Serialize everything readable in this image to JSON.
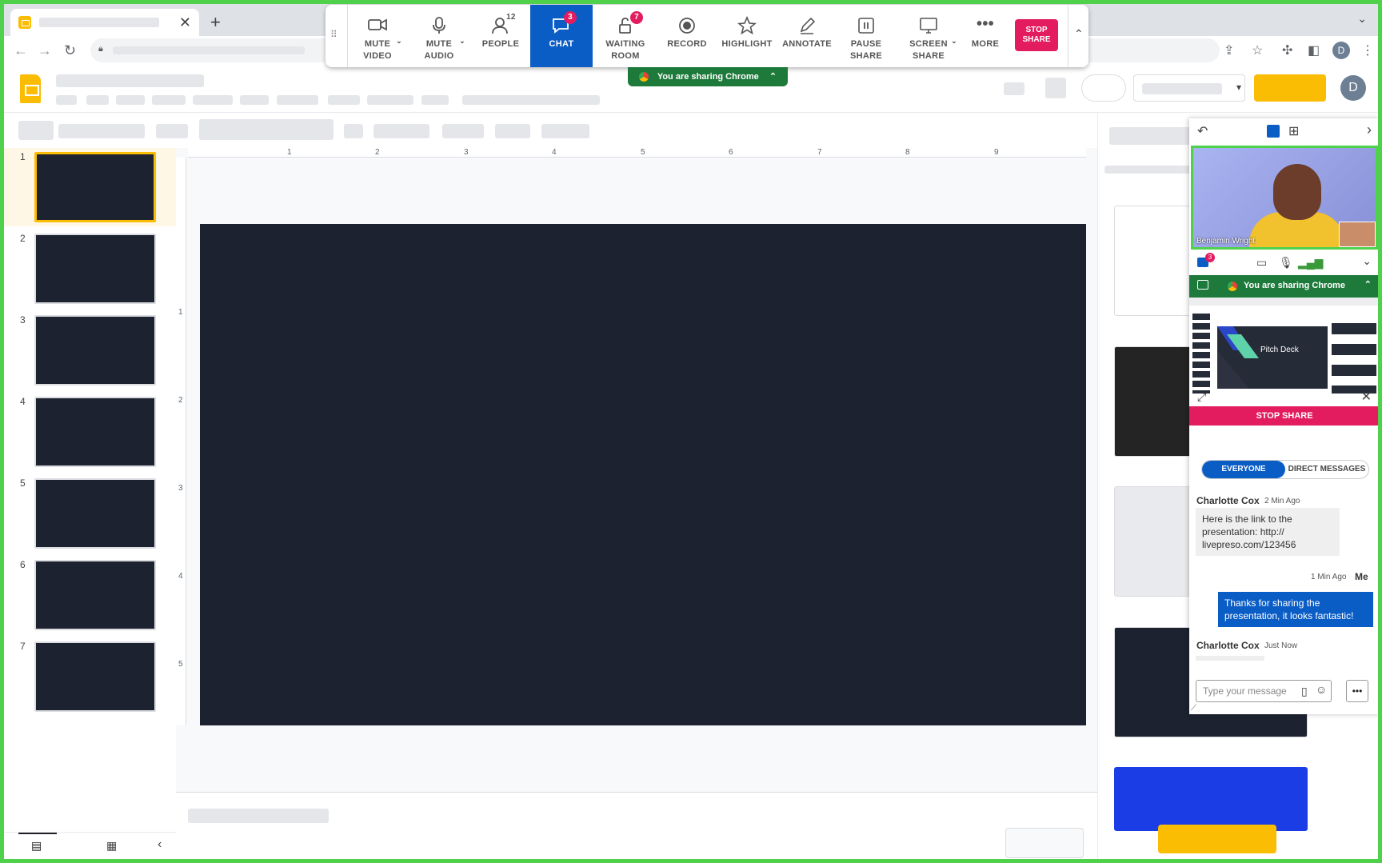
{
  "meeting_toolbar": {
    "items": [
      {
        "label1": "MUTE",
        "label2": "VIDEO"
      },
      {
        "label1": "MUTE",
        "label2": "AUDIO"
      },
      {
        "label1": "PEOPLE",
        "label2": "",
        "badge": "12"
      },
      {
        "label1": "CHAT",
        "label2": "",
        "badge": "3"
      },
      {
        "label1": "WAITING",
        "label2": "ROOM",
        "badge": "7"
      },
      {
        "label1": "RECORD",
        "label2": ""
      },
      {
        "label1": "HIGHLIGHT",
        "label2": ""
      },
      {
        "label1": "ANNOTATE",
        "label2": ""
      },
      {
        "label1": "PAUSE",
        "label2": "SHARE"
      },
      {
        "label1": "SCREEN",
        "label2": "SHARE"
      },
      {
        "label1": "MORE",
        "label2": ""
      }
    ],
    "stop_share_1": "STOP",
    "stop_share_2": "SHARE"
  },
  "sharing_banner": "You are sharing Chrome",
  "slides": {
    "numbers": [
      "1",
      "2",
      "3",
      "4",
      "5",
      "6",
      "7"
    ]
  },
  "ruler": {
    "h": [
      "1",
      "2",
      "3",
      "4",
      "5",
      "6",
      "7",
      "8",
      "9"
    ],
    "v": [
      "1",
      "2",
      "3",
      "4",
      "5"
    ]
  },
  "browser": {
    "profile_initial": "D"
  },
  "app": {
    "profile_initial": "D"
  },
  "panel": {
    "video_name": "Benjamin Wright",
    "chat_badge": "3",
    "sharing_text": "You are sharing Chrome",
    "preview_title": "Pitch Deck",
    "stop_share": "STOP SHARE",
    "tabs": [
      "EVERYONE",
      "DIRECT MESSAGES"
    ],
    "messages": [
      {
        "author": "Charlotte Cox",
        "time": "2 Min Ago",
        "text": "Here is the link to the presentation: http:// livepreso.com/123456"
      },
      {
        "author": "Me",
        "time": "1 Min Ago",
        "text": "Thanks for sharing the presentation, it  looks fantastic!"
      },
      {
        "author": "Charlotte Cox",
        "time": "Just Now",
        "text": ""
      }
    ],
    "input_placeholder": "Type your message"
  },
  "colors": {
    "accent": "#0b5dc6",
    "danger": "#e31c5f",
    "share_green": "#1e7a3b",
    "frame_green": "#4fd14b",
    "brand_yellow": "#fbbc04",
    "slide_dark": "#1c2230"
  }
}
